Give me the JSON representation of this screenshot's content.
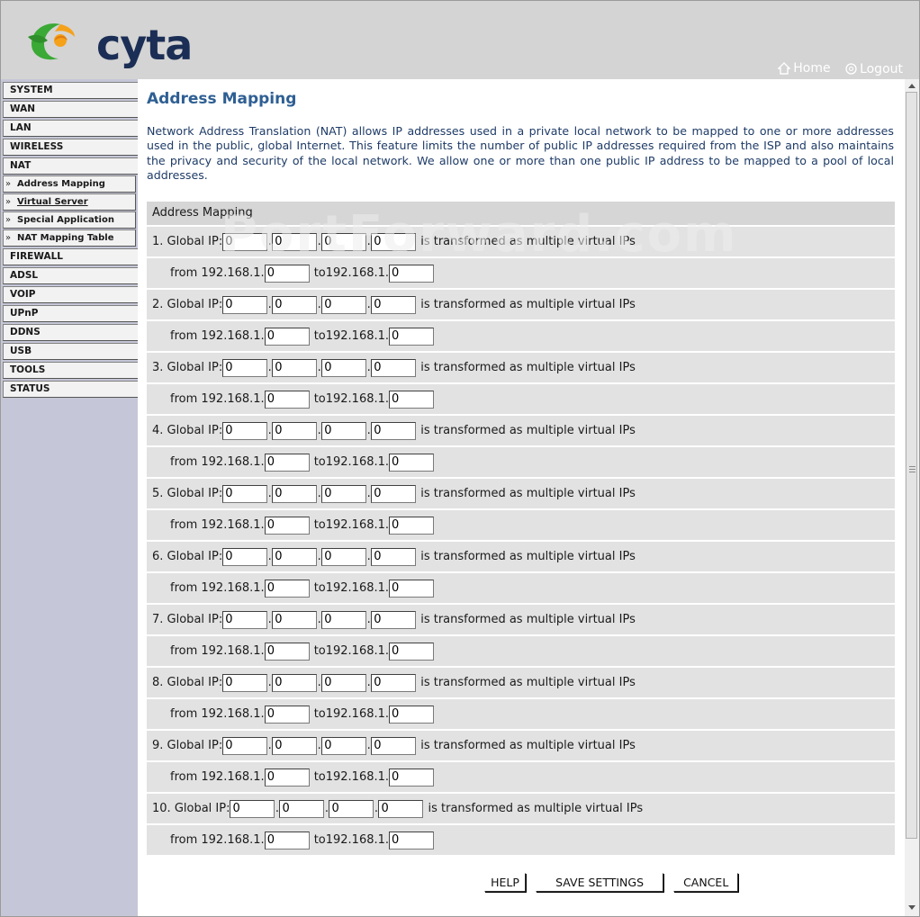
{
  "header": {
    "brand": "cyta",
    "links": {
      "home": "Home",
      "logout": "Logout"
    },
    "colors": {
      "header_bg": "#d4d4d4",
      "brand_text": "#1b2e55",
      "logo_green": "#3aa935",
      "logo_orange": "#f5a11a"
    }
  },
  "sidebar": {
    "items": [
      {
        "label": "SYSTEM",
        "type": "top"
      },
      {
        "label": "WAN",
        "type": "top"
      },
      {
        "label": "LAN",
        "type": "top"
      },
      {
        "label": "WIRELESS",
        "type": "top"
      },
      {
        "label": "NAT",
        "type": "top"
      },
      {
        "label": "Address Mapping",
        "type": "sub",
        "arrow": "»"
      },
      {
        "label": "Virtual Server",
        "type": "sub",
        "arrow": "»"
      },
      {
        "label": "Special Application",
        "type": "sub",
        "arrow": "»"
      },
      {
        "label": "NAT Mapping Table",
        "type": "sub",
        "arrow": "»"
      },
      {
        "label": "FIREWALL",
        "type": "top"
      },
      {
        "label": "ADSL",
        "type": "top"
      },
      {
        "label": "VOIP",
        "type": "top"
      },
      {
        "label": "UPnP",
        "type": "top"
      },
      {
        "label": "DDNS",
        "type": "top"
      },
      {
        "label": "USB",
        "type": "top"
      },
      {
        "label": "TOOLS",
        "type": "top"
      },
      {
        "label": "STATUS",
        "type": "top"
      }
    ]
  },
  "main": {
    "title": "Address Mapping",
    "description": "Network Address Translation (NAT) allows IP addresses used in a private local network to be mapped to one or more addresses used in the public, global Internet. This feature limits the number of public IP addresses required from the ISP and also maintains the privacy and security of the local network. We allow one or more than one public IP address to be mapped to a pool of local addresses.",
    "panel_title": "Address Mapping",
    "global_ip_label": "Global IP:",
    "transform_text": "is transformed as multiple virtual IPs",
    "from_label": "from 192.168.1.",
    "to_label": "to192.168.1.",
    "entries": [
      {
        "num": "1.",
        "global_ip": [
          "0",
          "0",
          "0",
          "0"
        ],
        "from": "0",
        "to": "0"
      },
      {
        "num": "2.",
        "global_ip": [
          "0",
          "0",
          "0",
          "0"
        ],
        "from": "0",
        "to": "0"
      },
      {
        "num": "3.",
        "global_ip": [
          "0",
          "0",
          "0",
          "0"
        ],
        "from": "0",
        "to": "0"
      },
      {
        "num": "4.",
        "global_ip": [
          "0",
          "0",
          "0",
          "0"
        ],
        "from": "0",
        "to": "0"
      },
      {
        "num": "5.",
        "global_ip": [
          "0",
          "0",
          "0",
          "0"
        ],
        "from": "0",
        "to": "0"
      },
      {
        "num": "6.",
        "global_ip": [
          "0",
          "0",
          "0",
          "0"
        ],
        "from": "0",
        "to": "0"
      },
      {
        "num": "7.",
        "global_ip": [
          "0",
          "0",
          "0",
          "0"
        ],
        "from": "0",
        "to": "0"
      },
      {
        "num": "8.",
        "global_ip": [
          "0",
          "0",
          "0",
          "0"
        ],
        "from": "0",
        "to": "0"
      },
      {
        "num": "9.",
        "global_ip": [
          "0",
          "0",
          "0",
          "0"
        ],
        "from": "0",
        "to": "0"
      },
      {
        "num": "10.",
        "global_ip": [
          "0",
          "0",
          "0",
          "0"
        ],
        "from": "0",
        "to": "0"
      }
    ],
    "buttons": {
      "help": "HELP",
      "save": "SAVE SETTINGS",
      "cancel": "CANCEL"
    }
  },
  "watermark": "PortForward.com"
}
